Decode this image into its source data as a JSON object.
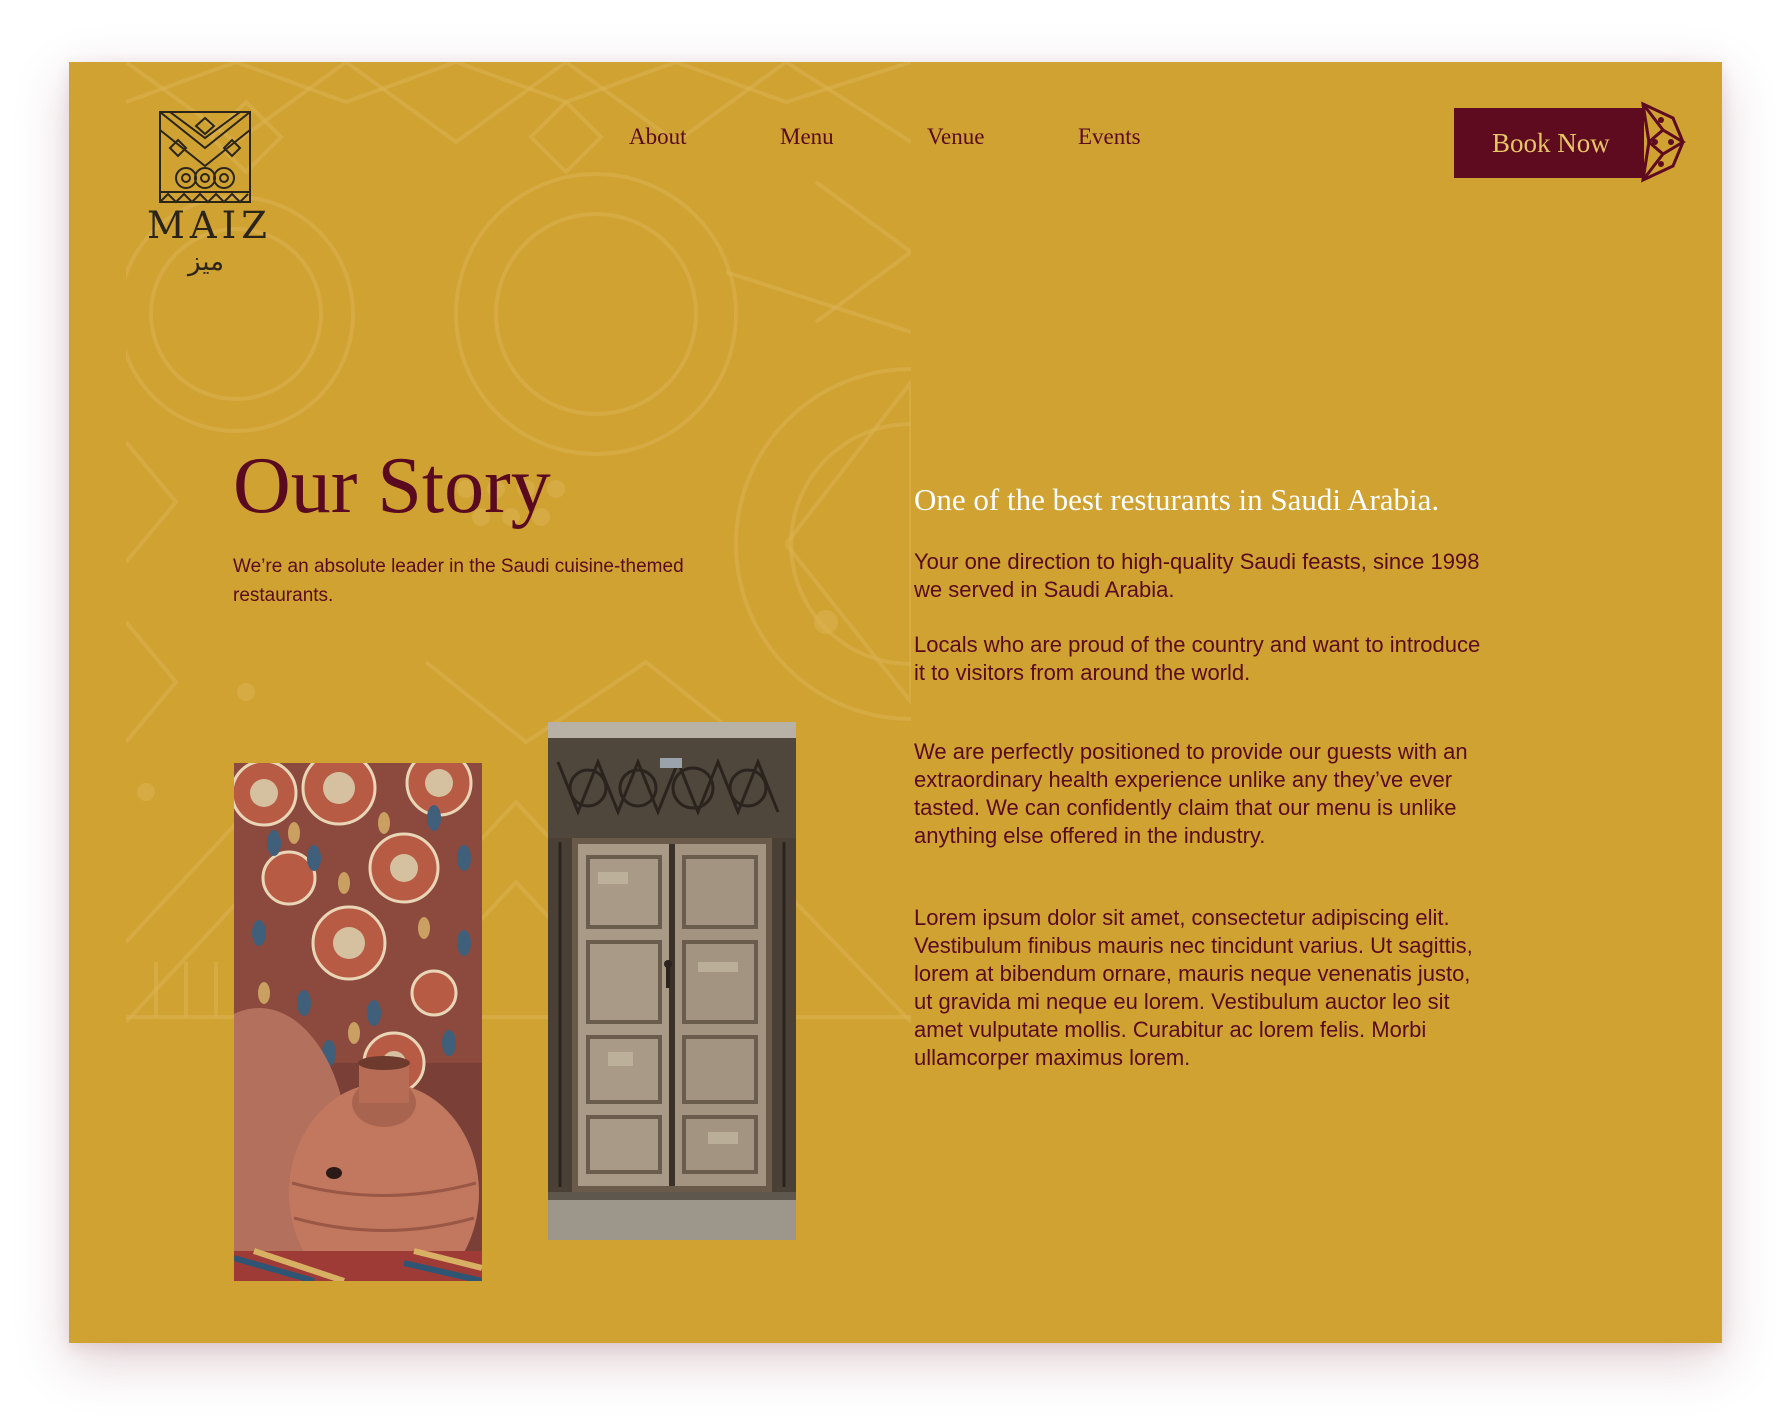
{
  "brand": {
    "name": "MAIZ",
    "arabic_name": "ميز"
  },
  "nav": {
    "items": [
      {
        "label": "About"
      },
      {
        "label": "Menu"
      },
      {
        "label": "Venue"
      },
      {
        "label": "Events"
      }
    ]
  },
  "header": {
    "book_label": "Book Now"
  },
  "story": {
    "title": "Our Story",
    "intro": "We’re an absolute leader in the Saudi cuisine-themed restaurants."
  },
  "about": {
    "tagline": "One of the best resturants in Saudi Arabia.",
    "paragraphs": [
      "Your one direction to high-quality Saudi feasts, since 1998 we served in Saudi Arabia.",
      "Locals who are proud of the country and want to introduce it to visitors from around the world.",
      "We are perfectly positioned to provide our guests with an extraordinary health experience unlike any they’ve ever tasted. We can confidently claim that our menu is unlike anything else offered in the industry.",
      "Lorem ipsum dolor sit amet, consectetur adipiscing elit. Vestibulum finibus mauris nec tincidunt varius. Ut sagittis, lorem at bibendum ornare, mauris neque venenatis justo, ut gravida mi neque eu lorem. Vestibulum auctor leo sit amet vulputate mollis. Curabitur ac lorem felis. Morbi ullamcorper maximus lorem."
    ]
  },
  "images": [
    {
      "subject": "handicraft-market-photo"
    },
    {
      "subject": "carved-wooden-door-photo"
    }
  ],
  "colors": {
    "background": "#CFA231",
    "accent": "#5e0a1f",
    "text": "#5a0a1e",
    "tagline": "#ffffff"
  }
}
